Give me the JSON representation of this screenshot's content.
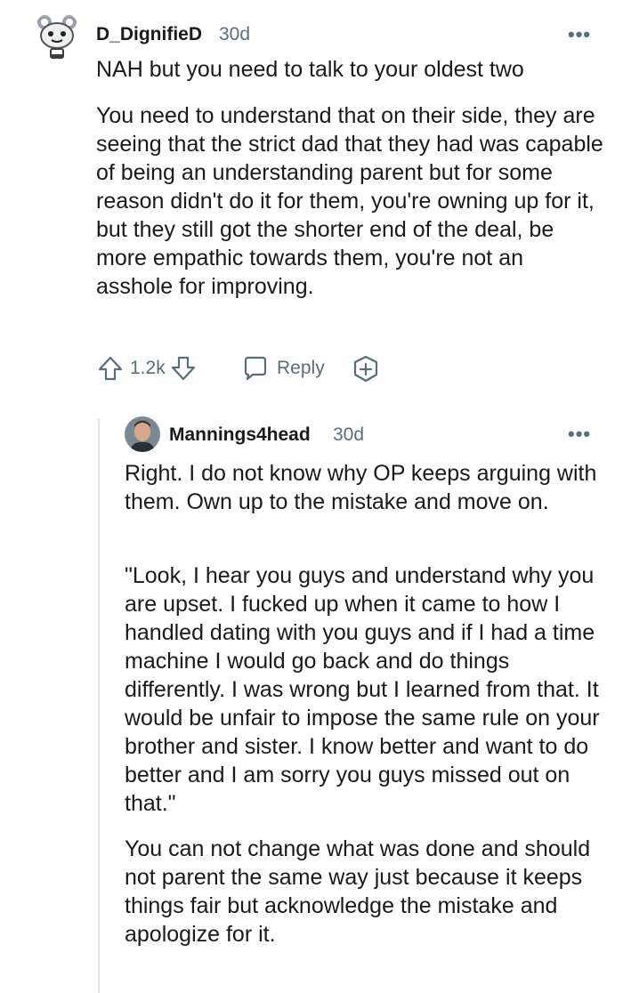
{
  "comment": {
    "username": "D_DignifieD",
    "age": "30d",
    "more_label": "•••",
    "paragraphs": [
      "NAH but you need to talk to your oldest two",
      "You need to understand that on their side, they are seeing that the strict dad that they had was capable of being an understanding parent but for some reason didn't do it for them, you're owning up for it, but they still got the shorter end of the deal, be more empathic towards them, you're not an asshole for improving."
    ],
    "score": "1.2k",
    "reply_label": "Reply",
    "icons": {
      "upvote": "upvote-arrow-icon",
      "downvote": "downvote-arrow-icon",
      "reply": "speech-bubble-icon",
      "award": "award-plus-icon"
    }
  },
  "reply": {
    "username": "Mannings4head",
    "age": "30d",
    "more_label": "•••",
    "paragraphs": [
      "Right. I do not know why OP keeps arguing with them. Own up to the mistake and move on.",
      "\"Look, I hear you guys and understand why you are upset. I fucked up when it came to how I handled dating with you guys and if I had a time machine I would go back and do things differently. I was wrong but I learned from that. It would be unfair to impose the same rule on your brother and sister. I know better and want to do better and I am sorry you guys missed out on that.\"",
      "You can not change what was done and should not parent the same way just because it keeps things fair but acknowledge the mistake and apologize for it."
    ]
  },
  "colors": {
    "text": "#1a1a1b",
    "muted": "#576f76",
    "thread_line": "#e3e6e8"
  }
}
